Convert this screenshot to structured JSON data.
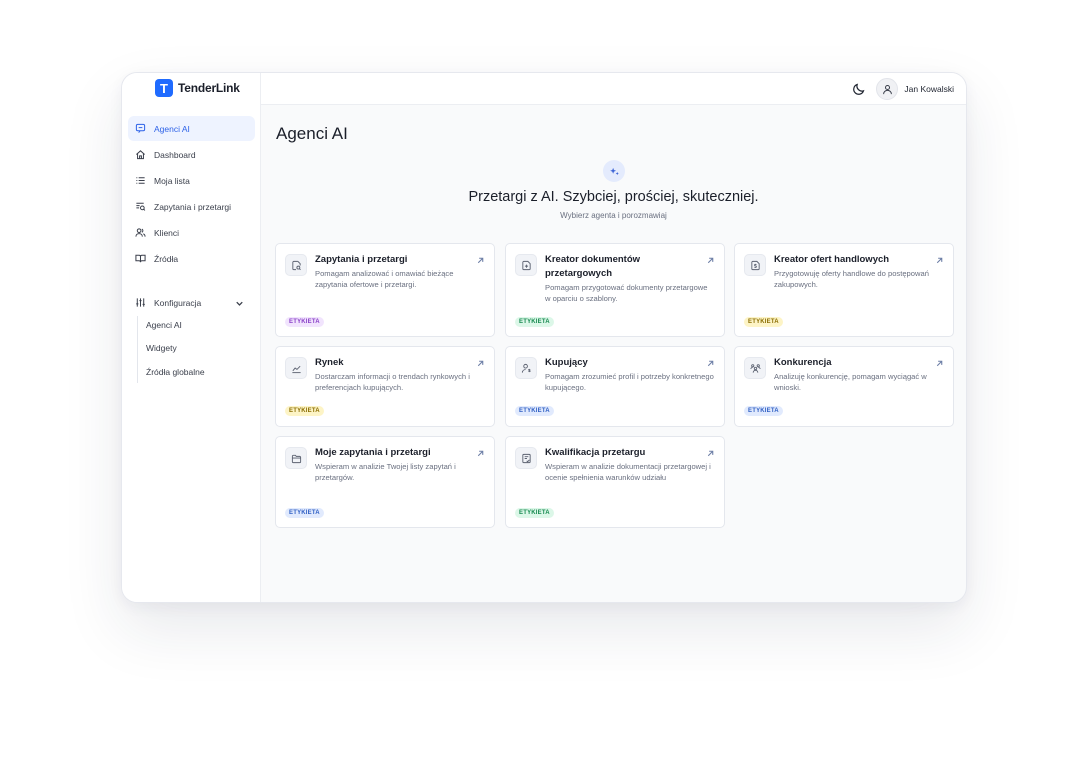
{
  "app": {
    "logo_letter": "T",
    "name": "TenderLink"
  },
  "sidebar": {
    "items": [
      {
        "label": "Agenci AI",
        "icon": "chat-icon",
        "active": true
      },
      {
        "label": "Dashboard",
        "icon": "home-icon"
      },
      {
        "label": "Moja lista",
        "icon": "list-icon"
      },
      {
        "label": "Zapytania i przetargi",
        "icon": "search-list-icon"
      },
      {
        "label": "Klienci",
        "icon": "users-icon"
      },
      {
        "label": "Źródła",
        "icon": "book-icon"
      }
    ],
    "config": {
      "label": "Konfiguracja",
      "icon": "sliders-icon",
      "expanded": true,
      "children": [
        "Agenci AI",
        "Widgety",
        "Źródła globalne"
      ]
    }
  },
  "topbar": {
    "theme_icon": "moon-icon",
    "user_name": "Jan Kowalski"
  },
  "page": {
    "title": "Agenci AI",
    "hero_icon": "sparkles-icon",
    "hero_title": "Przetargi z AI. Szybciej, prościej, skuteczniej.",
    "hero_subtitle": "Wybierz agenta i porozmawiaj"
  },
  "cards": [
    {
      "title": "Zapytania i przetargi",
      "description": "Pomagam analizować i omawiać bieżące zapytania ofertowe i przetargi.",
      "badge": "ETYKIETA",
      "badge_color": "#8a3fc8",
      "icon": "document-search-icon"
    },
    {
      "title": "Kreator dokumentów przetargowych",
      "description": "Pomagam przygotować dokumenty przetargowe w oparciu o szablony.",
      "badge": "ETYKIETA",
      "badge_color": "#168a4f",
      "icon": "document-plus-icon"
    },
    {
      "title": "Kreator ofert handlowych",
      "description": "Przygotowuję oferty handlowe do postępowań zakupowych.",
      "badge": "ETYKIETA",
      "badge_color": "#8a6d00",
      "icon": "document-dollar-icon"
    },
    {
      "title": "Rynek",
      "description": "Dostarczam informacji o trendach rynkowych i preferencjach kupujących.",
      "badge": "ETYKIETA",
      "badge_color": "#8a6d00",
      "icon": "trend-chart-icon"
    },
    {
      "title": "Kupujący",
      "description": "Pomagam zrozumieć profil i potrzeby konkretnego kupującego.",
      "badge": "ETYKIETA",
      "badge_color": "#2f5fc4",
      "icon": "user-dollar-icon"
    },
    {
      "title": "Konkurencja",
      "description": "Analizuję konkurencję, pomagam wyciągać w wnioski.",
      "badge": "ETYKIETA",
      "badge_color": "#2f5fc4",
      "icon": "team-icon"
    },
    {
      "title": "Moje zapytania i przetargi",
      "description": "Wspieram w analizie Twojej listy zapytań i przetargów.",
      "badge": "ETYKIETA",
      "badge_color": "#2f5fc4",
      "icon": "folder-icon"
    },
    {
      "title": "Kwalifikacja przetargu",
      "description": "Wspieram w analizie dokumentacji przetargowej i ocenie spełnienia warunków udziału",
      "badge": "ETYKIETA",
      "badge_color": "#168a4f",
      "icon": "clipboard-check-icon"
    }
  ]
}
